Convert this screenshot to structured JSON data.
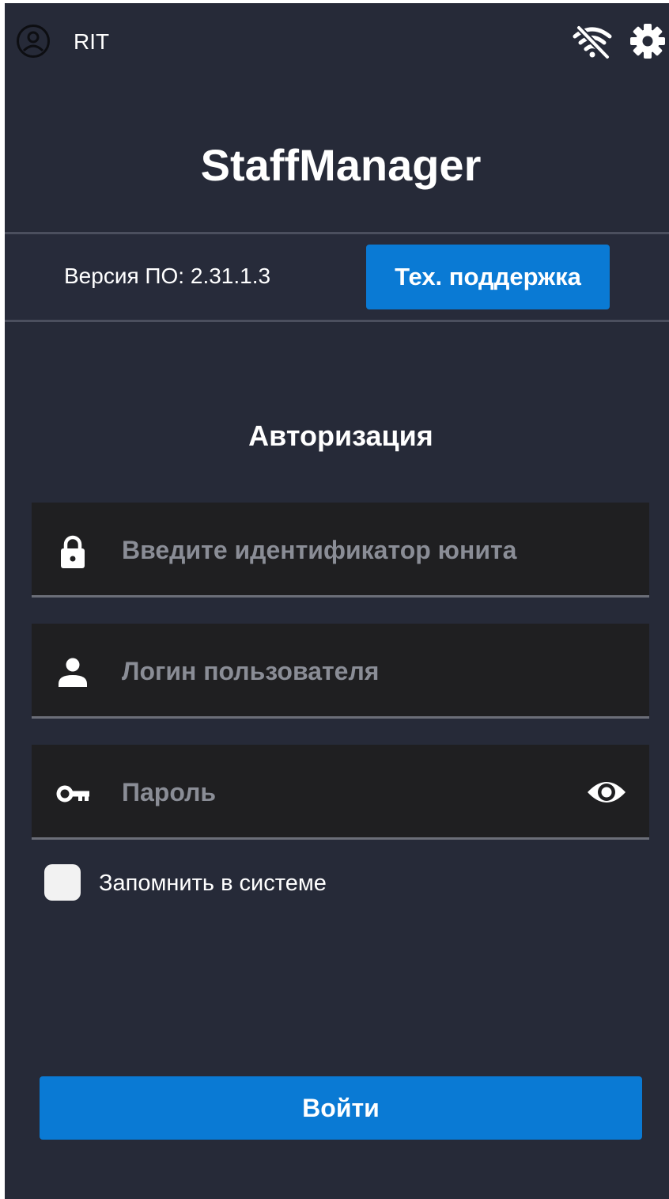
{
  "header": {
    "account_icon": "account-circle-icon",
    "user_name": "RIT",
    "wifi_icon": "wifi-off-icon",
    "settings_icon": "gear-icon"
  },
  "app": {
    "title": "StaffManager"
  },
  "version_bar": {
    "version_text": "Версия ПО: 2.31.1.3",
    "support_label": "Тех. поддержка"
  },
  "auth": {
    "title": "Авторизация",
    "unit_id": {
      "icon": "lock-icon",
      "value": "",
      "placeholder": "Введите идентификатор юнита"
    },
    "login": {
      "icon": "person-icon",
      "value": "",
      "placeholder": "Логин пользователя"
    },
    "password": {
      "icon": "key-icon",
      "value": "",
      "placeholder": "Пароль",
      "toggle_icon": "eye-icon"
    },
    "remember": {
      "label": "Запомнить в системе",
      "checked": false
    },
    "submit_label": "Войти"
  },
  "colors": {
    "background": "#262a38",
    "field_background": "#1f1f21",
    "accent": "#0a7ad4",
    "placeholder": "#8a8d96"
  }
}
